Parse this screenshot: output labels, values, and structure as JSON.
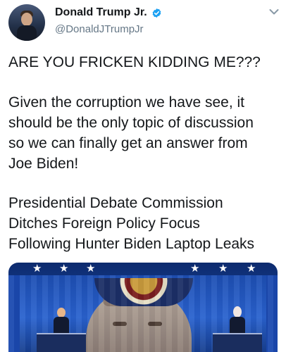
{
  "tweet": {
    "author_name": "Donald Trump Jr.",
    "handle": "@DonaldJTrumpJr",
    "line1": "ARE YOU FRICKEN KIDDING ME???",
    "para2": "Given the corruption we have see, it\nshould be the only topic of discussion\nso we can finally get an answer from\nJoe Biden!",
    "para3": "Presidential Debate Commission\nDitches Foreign Policy Focus\nFollowing Hunter Biden Laptop Leaks"
  },
  "icons": {
    "verified": "verified-badge-icon",
    "menu": "chevron-down-icon"
  },
  "colors": {
    "verified": "#1da1f2",
    "handle": "#657786",
    "text": "#14171a"
  }
}
